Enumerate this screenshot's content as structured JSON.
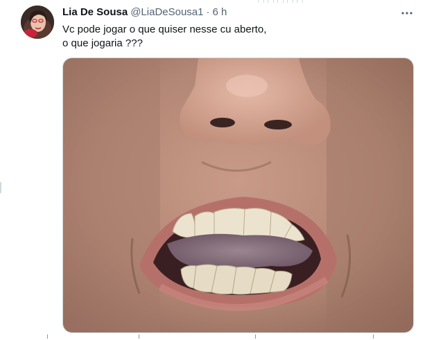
{
  "tweet": {
    "author": {
      "display_name": "Lia De Sousa",
      "handle": "@LiaDeSousa1",
      "separator": "·",
      "time": "6 h",
      "avatar_icon": "avatar-photo"
    },
    "text_lines": [
      "Vc pode jogar o que quiser nesse cu aberto,",
      "o que jogaria ???"
    ],
    "more_icon": "more-horizontal-icon",
    "media": {
      "kind": "photo",
      "subject": "close-up of nose and open mouth"
    }
  },
  "colors": {
    "text_primary": "#0f1419",
    "text_secondary": "#536471",
    "border": "#cfd9de"
  }
}
